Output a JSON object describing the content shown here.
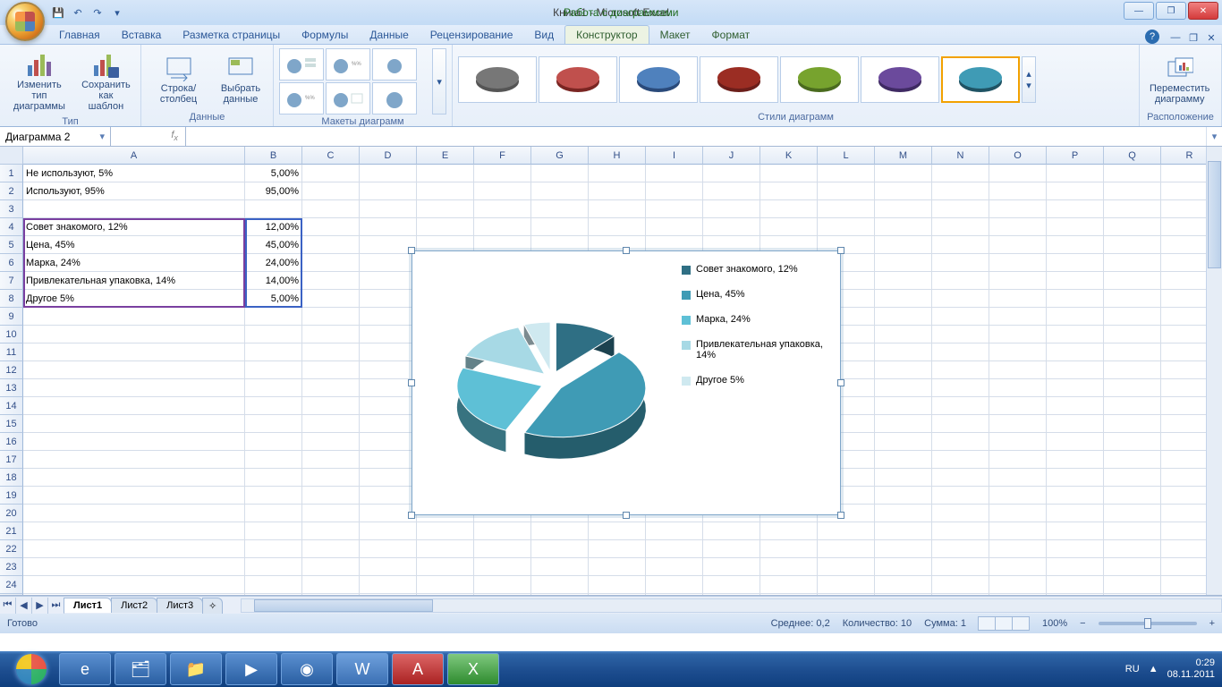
{
  "title": "Книга1 - Microsoft Excel",
  "chart_tools_title": "Работа с диаграммами",
  "tabs": {
    "home": "Главная",
    "insert": "Вставка",
    "pagelayout": "Разметка страницы",
    "formulas": "Формулы",
    "data": "Данные",
    "review": "Рецензирование",
    "view": "Вид",
    "design": "Конструктор",
    "layout": "Макет",
    "format": "Формат"
  },
  "ribbon": {
    "type_group": "Тип",
    "change_type": "Изменить тип\nдиаграммы",
    "save_template": "Сохранить\nкак шаблон",
    "data_group": "Данные",
    "switch_rc": "Строка/столбец",
    "select_data": "Выбрать\nданные",
    "layouts_group": "Макеты диаграмм",
    "styles_group": "Стили диаграмм",
    "location_group": "Расположение",
    "move_chart": "Переместить\nдиаграмму"
  },
  "namebox": "Диаграмма 2",
  "columns": [
    "A",
    "B",
    "C",
    "D",
    "E",
    "F",
    "G",
    "H",
    "I",
    "J",
    "K",
    "L",
    "M",
    "N",
    "O",
    "P",
    "Q",
    "R"
  ],
  "rows_shown": 25,
  "cells": {
    "A1": "Не используют, 5%",
    "B1": "5,00%",
    "A2": "Используют, 95%",
    "B2": "95,00%",
    "A4": "Совет знакомого, 12%",
    "B4": "12,00%",
    "A5": "Цена, 45%",
    "B5": "45,00%",
    "A6": "Марка, 24%",
    "B6": "24,00%",
    "A7": "Привлекательная упаковка, 14%",
    "B7": "14,00%",
    "A8": "Другое 5%",
    "B8": "5,00%"
  },
  "chart_data": {
    "type": "pie",
    "title": "",
    "series": [
      {
        "name": "",
        "categories": [
          "Совет знакомого, 12%",
          "Цена, 45%",
          "Марка, 24%",
          "Привлекательная упаковка, 14%",
          "Другое 5%"
        ],
        "values": [
          12,
          45,
          24,
          14,
          5
        ]
      }
    ],
    "colors": [
      "#2f6f84",
      "#3f9bb5",
      "#5ec0d6",
      "#a7d9e5",
      "#cfe9f0"
    ]
  },
  "legend": [
    {
      "label": "Совет знакомого, 12%",
      "color": "#2f6f84"
    },
    {
      "label": "Цена, 45%",
      "color": "#3f9bb5"
    },
    {
      "label": "Марка, 24%",
      "color": "#5ec0d6"
    },
    {
      "label": "Привлекательная упаковка, 14%",
      "color": "#a7d9e5"
    },
    {
      "label": "Другое 5%",
      "color": "#cfe9f0"
    }
  ],
  "sheets": {
    "s1": "Лист1",
    "s2": "Лист2",
    "s3": "Лист3"
  },
  "status": {
    "ready": "Готово",
    "avg_label": "Среднее:",
    "avg": "0,2",
    "count_label": "Количество:",
    "count": "10",
    "sum_label": "Сумма:",
    "sum": "1",
    "zoom": "100%"
  },
  "tray": {
    "lang": "RU",
    "time": "0:29",
    "date": "08.11.2011"
  }
}
